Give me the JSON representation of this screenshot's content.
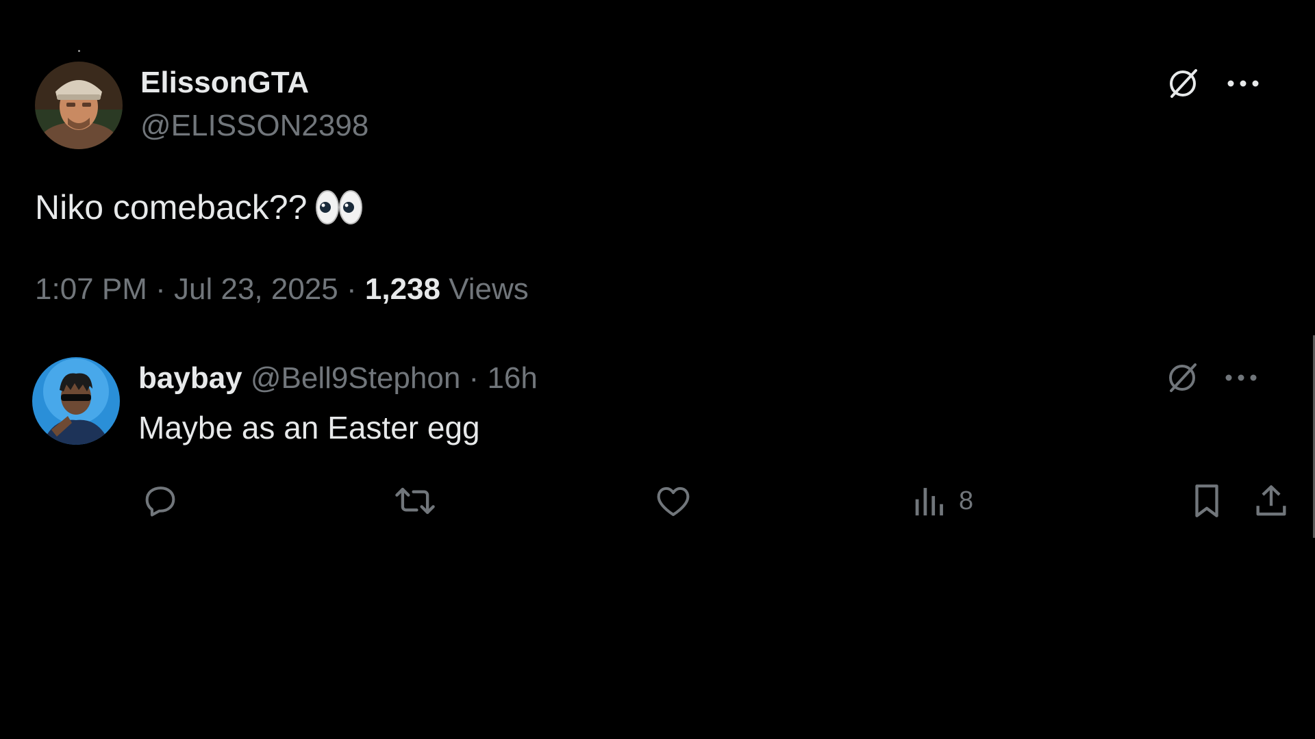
{
  "main_tweet": {
    "author_name": "ElissonGTA",
    "author_handle": "@ELISSON2398",
    "text": "Niko comeback??",
    "emoji_icon": "eyes-emoji",
    "time": "1:07 PM",
    "date": "Jul 23, 2025",
    "views_count": "1,238",
    "views_label": "Views"
  },
  "reply": {
    "author_name": "baybay",
    "author_handle": "@Bell9Stephon",
    "separator": "·",
    "age": "16h",
    "text": "Maybe as an Easter egg",
    "actions": {
      "reply_icon": "reply-icon",
      "repost_icon": "repost-icon",
      "like_icon": "heart-icon",
      "views_icon": "analytics-icon",
      "views_count": "8",
      "bookmark_icon": "bookmark-icon",
      "share_icon": "share-icon"
    }
  },
  "colors": {
    "background": "#000000",
    "primary_text": "#e7e9ea",
    "secondary_text": "#71767b"
  }
}
